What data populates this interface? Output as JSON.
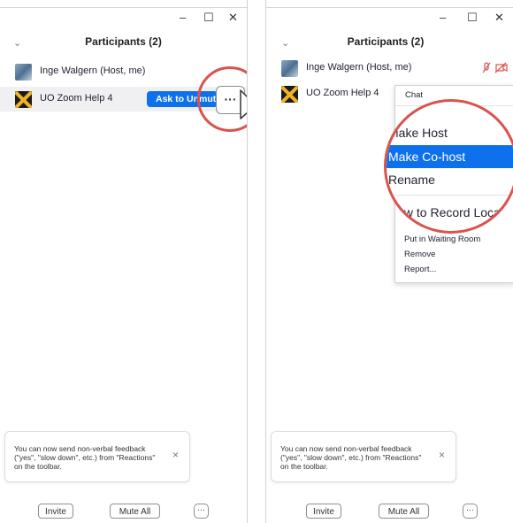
{
  "window": {
    "minimize_glyph": "–",
    "maximize_glyph": "☐",
    "close_glyph": "✕",
    "collapse_glyph": "⌄"
  },
  "left_panel": {
    "title": "Participants (2)",
    "participants": [
      {
        "name": "Inge Walgern (Host, me)",
        "avatar": "photo"
      },
      {
        "name": "UO Zoom Help 4",
        "avatar": "uo-logo",
        "action_label": "Ask to Unmute"
      }
    ],
    "more_button_glyph": "···",
    "toast": {
      "text": "You can now send non-verbal feedback (\"yes\", \"slow down\", etc.) from \"Reactions\" on the toolbar.",
      "close_glyph": "×"
    },
    "footer": {
      "invite": "Invite",
      "mute_all": "Mute All",
      "more": "···"
    }
  },
  "right_panel": {
    "title": "Participants (2)",
    "participants": [
      {
        "name": "Inge Walgern (Host, me)",
        "avatar": "photo",
        "status_icons": "🎤̸ 📹̸"
      },
      {
        "name": "UO Zoom Help 4",
        "avatar": "uo-logo"
      }
    ],
    "context_menu": {
      "items": [
        "Chat",
        "Make Host",
        "Make Co-host",
        "Rename",
        "How to Record Locally",
        "Put in Waiting Room",
        "Remove",
        "Report..."
      ],
      "zoomed_items": [
        "Make Host",
        "Make Co-host",
        "Rename",
        "How to Record Locally"
      ],
      "selected": "Make Co-host"
    },
    "toast": {
      "text": "You can now send non-verbal feedback (\"yes\", \"slow down\", etc.) from \"Reactions\" on the toolbar.",
      "close_glyph": "×"
    },
    "footer": {
      "invite": "Invite",
      "mute_all": "Mute All",
      "more": "···"
    }
  },
  "colors": {
    "accent": "#0e71eb",
    "highlight_ring": "#d9534f",
    "row_highlight": "#f0f0f2"
  }
}
